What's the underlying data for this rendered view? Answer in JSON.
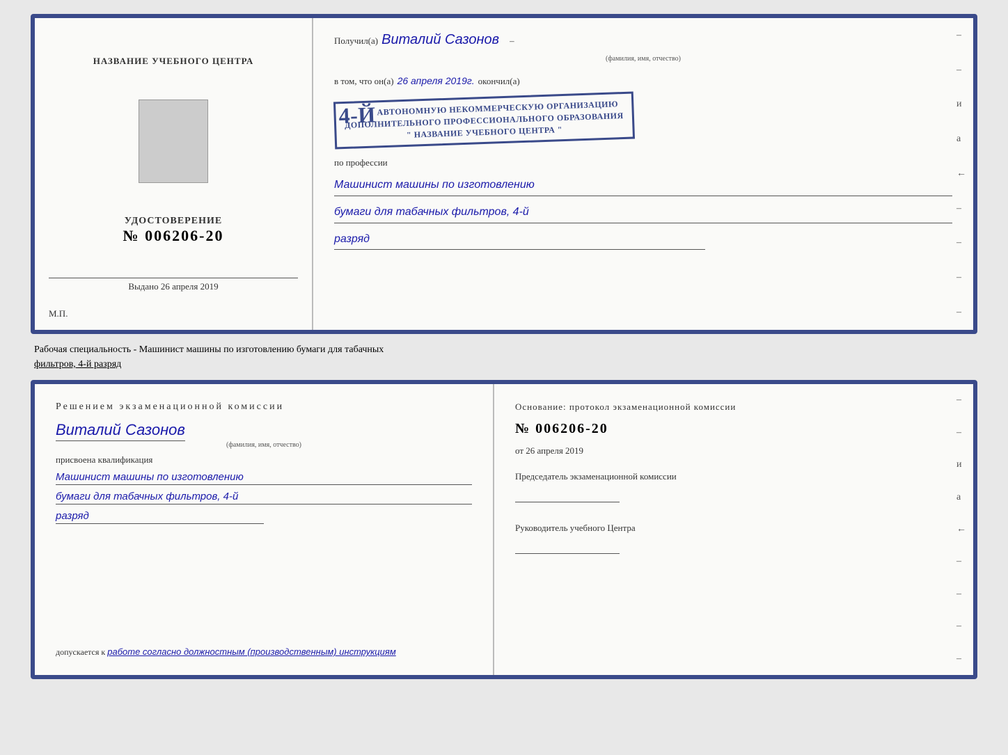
{
  "top_cert": {
    "left": {
      "title": "НАЗВАНИЕ УЧЕБНОГО ЦЕНТРА",
      "udostoverenie_label": "УДОСТОВЕРЕНИЕ",
      "number": "№ 006206-20",
      "vydano_label": "Выдано",
      "vydano_date": "26 апреля 2019",
      "mp": "М.П."
    },
    "right": {
      "poluchil_label": "Получил(a)",
      "poluchil_name": "Виталий Сазонов",
      "fio_subtitle": "(фамилия, имя, отчество)",
      "vtom_label": "в том, что он(а)",
      "date_handwritten": "26 апреля 2019г.",
      "okonchil_label": "окончил(а)",
      "stamp_number": "4-й",
      "stamp_line1": "АВТОНОМНУЮ НЕКОММЕРЧЕСКУЮ ОРГАНИЗАЦИЮ",
      "stamp_line2": "ДОПОЛНИТЕЛЬНОГО ПРОФЕССИОНАЛЬНОГО ОБРАЗОВАНИЯ",
      "stamp_line3": "\" НАЗВАНИЕ УЧЕБНОГО ЦЕНТРА \"",
      "i_right": "и",
      "a_right": "а",
      "arrow_right": "←",
      "po_professii": "по профессии",
      "profession_line1": "Машинист машины по изготовлению",
      "profession_line2": "бумаги для табачных фильтров, 4-й",
      "profession_line3": "разряд"
    }
  },
  "middle": {
    "text": "Рабочая специальность - Машинист машины по изготовлению бумаги для табачных",
    "text2_underline": "фильтров, 4-й разряд"
  },
  "bottom_cert": {
    "left": {
      "resheniem": "Решением  экзаменационной  комиссии",
      "name": "Виталий Сазонов",
      "fio_subtitle": "(фамилия, имя, отчество)",
      "prisvoena": "присвоена квалификация",
      "qualification_line1": "Машинист машины по изготовлению",
      "qualification_line2": "бумаги для табачных фильтров, 4-й",
      "qualification_line3": "разряд",
      "dopuskaetsya_label": "допускается к",
      "dopuskaetsya_value": "работе согласно должностным (производственным) инструкциям"
    },
    "right": {
      "osnovaniye": "Основание: протокол экзаменационной  комиссии",
      "number": "№  006206-20",
      "ot_label": "от",
      "ot_date": "26 апреля 2019",
      "predsedatel_label": "Председатель экзаменационной комиссии",
      "rukovoditel_label": "Руководитель учебного Центра",
      "i_right": "и",
      "a_right": "а",
      "arrow_right": "←"
    }
  }
}
